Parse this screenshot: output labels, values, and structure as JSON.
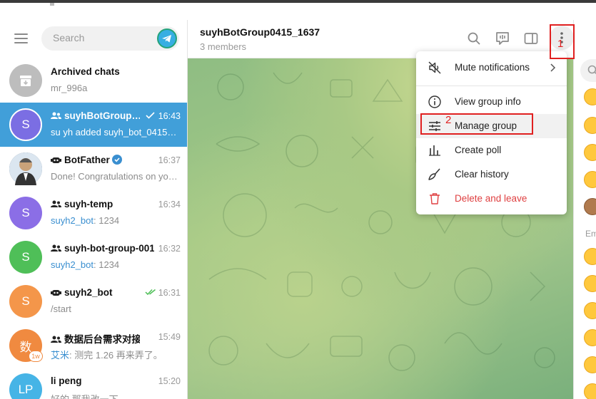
{
  "sidebar": {
    "search_placeholder": "Search",
    "chats": [
      {
        "name": "Archived chats",
        "preview": "mr_996a",
        "time": "",
        "avatar_color": "#bdbdbd"
      },
      {
        "name": "suyhBotGroup…",
        "preview": "su yh added suyh_bot_0415_…",
        "time": "16:43",
        "avatar_letter": "S",
        "avatar_color": "#7b6ee3"
      },
      {
        "name": "BotFather",
        "preview": "Done! Congratulations on yo…",
        "time": "16:37",
        "avatar_color": "#3a5b7c"
      },
      {
        "name": "suyh-temp",
        "sender": "suyh2_bot",
        "preview": ": 1234",
        "time": "16:34",
        "avatar_letter": "S",
        "avatar_color": "#8b6ee6"
      },
      {
        "name": "suyh-bot-group-001",
        "sender": "suyh2_bot",
        "preview": ": 1234",
        "time": "16:32",
        "avatar_letter": "S",
        "avatar_color": "#4fbf58"
      },
      {
        "name": "suyh2_bot",
        "preview": "/start",
        "time": "16:31",
        "avatar_letter": "S",
        "avatar_color": "#f4964a"
      },
      {
        "name": "数据后台需求对接",
        "sender": "艾米",
        "preview": ": 测完 1.26 再来弄了。",
        "time": "15:49",
        "avatar_letter": "数",
        "avatar_color": "#f08a40",
        "badge": "1w"
      },
      {
        "name": "li peng",
        "preview": "好的 那我改一下",
        "time": "15:20",
        "avatar_letter": "LP",
        "avatar_color": "#46b4e6"
      }
    ]
  },
  "chat": {
    "title": "suyhBotGroup0415_1637",
    "subtitle": "3 members"
  },
  "menu": {
    "items": [
      {
        "label": "Mute notifications",
        "icon": "mute-icon"
      },
      {
        "label": "View group info",
        "icon": "info-icon"
      },
      {
        "label": "Manage group",
        "icon": "sliders-icon"
      },
      {
        "label": "Create poll",
        "icon": "poll-icon"
      },
      {
        "label": "Clear history",
        "icon": "broom-icon"
      },
      {
        "label": "Delete and leave",
        "icon": "trash-icon"
      }
    ]
  },
  "annotations": {
    "label_1": "1",
    "label_2": "2"
  },
  "right_panel": {
    "section_label": "Em"
  },
  "colors": {
    "accent": "#419fd9",
    "danger": "#df3f40",
    "annotation": "#e02020"
  }
}
